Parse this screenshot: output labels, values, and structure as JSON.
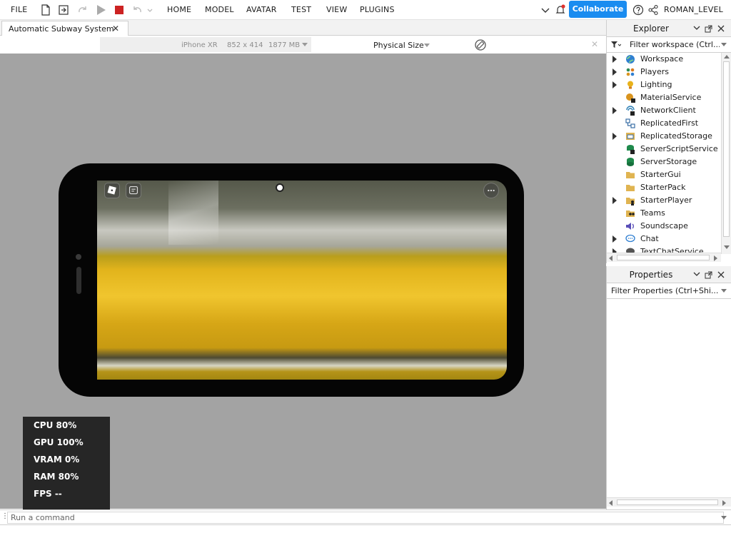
{
  "menubar": {
    "file": "FILE",
    "home": "HOME",
    "model": "MODEL",
    "avatar": "AVATAR",
    "test": "TEST",
    "view": "VIEW",
    "plugins": "PLUGINS",
    "collaborate": "Collaborate",
    "username": "ROMAN_LEVEL"
  },
  "tabs": {
    "document": "Automatic Subway System",
    "close": "✕"
  },
  "device_bar": {
    "device": "iPhone XR",
    "resolution": "852 x 414",
    "memory": "1877 MB",
    "size_mode": "Physical Size"
  },
  "stats": {
    "cpu": "CPU  80%",
    "gpu": "GPU 100%",
    "vram": "VRAM   0%",
    "ram": "RAM  80%",
    "fps": "FPS   --"
  },
  "command_bar": {
    "placeholder": "Run a command"
  },
  "explorer": {
    "title": "Explorer",
    "filter": "Filter workspace (Ctrl...",
    "items": [
      {
        "label": "Workspace",
        "icon": "globe-icon",
        "color": "#2f7fd1"
      },
      {
        "label": "Players",
        "icon": "players-icon",
        "color": "#d97a1e"
      },
      {
        "label": "Lighting",
        "icon": "bulb-icon",
        "color": "#e8b21b"
      },
      {
        "label": "MaterialService",
        "icon": "material-icon",
        "color": "#d9941e"
      },
      {
        "label": "NetworkClient",
        "icon": "network-icon",
        "color": "#2c7fb5"
      },
      {
        "label": "ReplicatedFirst",
        "icon": "replicated-first-icon",
        "color": "#3a6ea5"
      },
      {
        "label": "ReplicatedStorage",
        "icon": "replicated-storage-icon",
        "color": "#d9941e"
      },
      {
        "label": "ServerScriptService",
        "icon": "server-script-icon",
        "color": "#1f8a4c"
      },
      {
        "label": "ServerStorage",
        "icon": "server-storage-icon",
        "color": "#1f8a4c"
      },
      {
        "label": "StarterGui",
        "icon": "folder-icon",
        "color": "#e0b451"
      },
      {
        "label": "StarterPack",
        "icon": "folder-icon",
        "color": "#e0b451"
      },
      {
        "label": "StarterPlayer",
        "icon": "folder-icon",
        "color": "#e0b451"
      },
      {
        "label": "Teams",
        "icon": "teams-icon",
        "color": "#e0b451"
      },
      {
        "label": "Soundscape",
        "icon": "sound-icon",
        "color": "#5a4fb8"
      },
      {
        "label": "Chat",
        "icon": "chat-icon",
        "color": "#2f7fd1"
      },
      {
        "label": "TextChatService",
        "icon": "chat-icon",
        "color": "#555555"
      }
    ]
  },
  "properties": {
    "title": "Properties",
    "filter": "Filter Properties (Ctrl+Shi..."
  },
  "colors": {
    "accent": "#1a8cf0",
    "viewport_bg": "#a3a3a3",
    "stop_red": "#cc2222"
  }
}
